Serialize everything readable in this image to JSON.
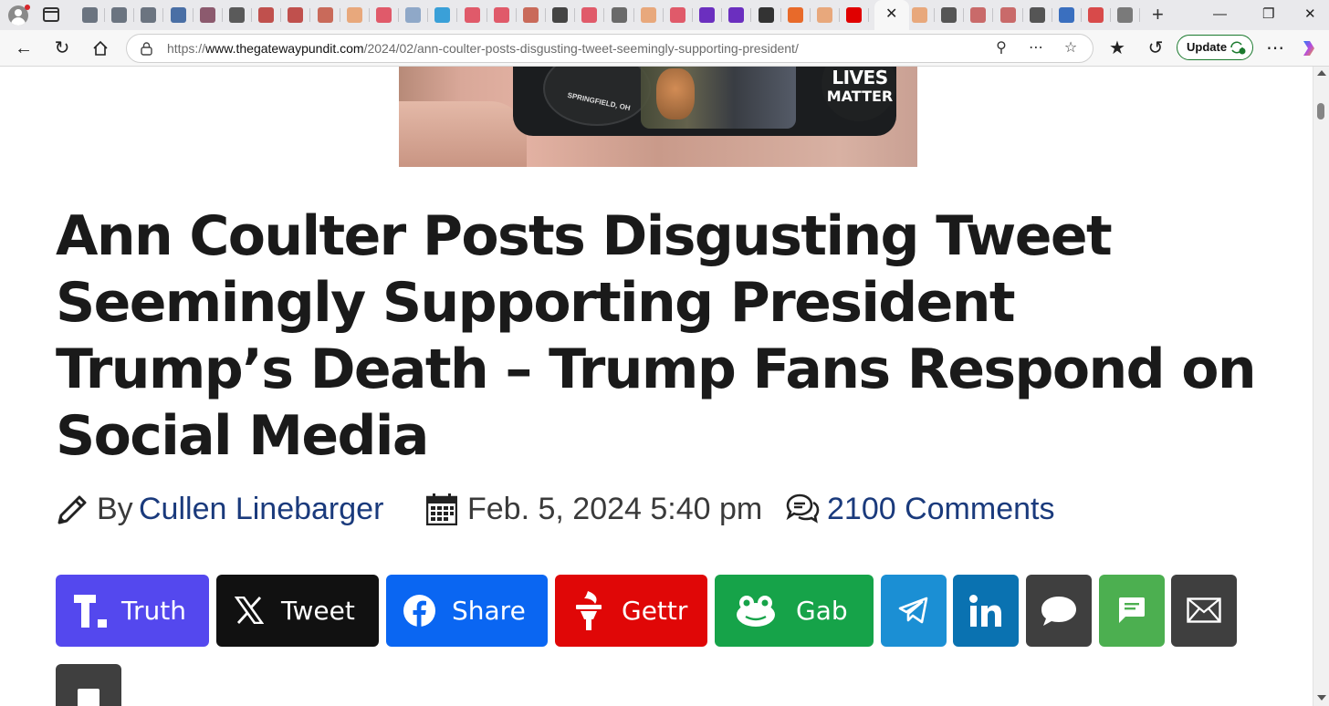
{
  "browser": {
    "tabs": [
      {
        "icon": "globe-icon",
        "color": "#6b7480"
      },
      {
        "icon": "globe-icon",
        "color": "#6b7480"
      },
      {
        "icon": "globe-icon",
        "color": "#6b7480"
      },
      {
        "icon": "news-icon",
        "color": "#4a6fa5"
      },
      {
        "icon": "tag-icon",
        "color": "#8c5a6e"
      },
      {
        "icon": "arrow-icon",
        "color": "#5a5a5a"
      },
      {
        "icon": "r-icon",
        "color": "#c0504d"
      },
      {
        "icon": "r-icon",
        "color": "#c0504d"
      },
      {
        "icon": "doc-icon",
        "color": "#c96a5a"
      },
      {
        "icon": "circle-icon",
        "color": "#e8a87c"
      },
      {
        "icon": "play-icon",
        "color": "#e05a6a"
      },
      {
        "icon": "pen-icon",
        "color": "#8fa8c8"
      },
      {
        "icon": "c-icon",
        "color": "#3aa0d8"
      },
      {
        "icon": "play-icon",
        "color": "#e05a6a"
      },
      {
        "icon": "play-icon",
        "color": "#e05a6a"
      },
      {
        "icon": "doc-icon",
        "color": "#c96a5a"
      },
      {
        "icon": "nr-icon",
        "color": "#444444"
      },
      {
        "icon": "play-icon",
        "color": "#e05a6a"
      },
      {
        "icon": "gp-icon",
        "color": "#6a6a6a"
      },
      {
        "icon": "b-icon",
        "color": "#e8a87c"
      },
      {
        "icon": "play-icon",
        "color": "#e05a6a"
      },
      {
        "icon": "yahoo-icon",
        "color": "#6b2fbf"
      },
      {
        "icon": "yahoo-icon",
        "color": "#6b2fbf"
      },
      {
        "icon": "ap-icon",
        "color": "#333333"
      },
      {
        "icon": "bookmark-icon",
        "color": "#e86a2a"
      },
      {
        "icon": "bookmark-icon",
        "color": "#e8a87c"
      },
      {
        "icon": "youtube-icon",
        "color": "#e00000"
      }
    ],
    "tabs_after": [
      {
        "icon": "bookmark-icon",
        "color": "#e8a87c"
      },
      {
        "icon": "r-icon",
        "color": "#555555"
      },
      {
        "icon": "m-icon",
        "color": "#c96a6a"
      },
      {
        "icon": "m-icon",
        "color": "#c96a6a"
      },
      {
        "icon": "r-icon",
        "color": "#555555"
      },
      {
        "icon": "h-icon",
        "color": "#3a6fbf"
      },
      {
        "icon": "s-icon",
        "color": "#d84a4a"
      },
      {
        "icon": "google-icon",
        "color": "#7a7a7a"
      }
    ],
    "active_tab_close": "✕",
    "new_tab": "+",
    "url_prefix": "https://",
    "url_host": "www.thegatewaypundit.com",
    "url_path": "/2024/02/ann-coulter-posts-disgusting-tweet-seemingly-supporting-president/",
    "update_label": "Update"
  },
  "article": {
    "headline": "Ann Coulter Posts Disgusting Tweet Seemingly Supporting President Trump’s Death – Trump Fans Respond on Social Media",
    "by_label": "By",
    "author": "Cullen Linebarger",
    "date": "Feb. 5, 2024 5:40 pm",
    "comments": "2100 Comments",
    "ad_text": {
      "lives": "LIVES",
      "matter": "MATTER",
      "springfield": "SPRINGFIELD, OH"
    }
  },
  "share_buttons": [
    {
      "label": "Truth",
      "color": "#5448ee",
      "icon": "truth-icon"
    },
    {
      "label": "Tweet",
      "color": "#111111",
      "icon": "x-icon"
    },
    {
      "label": "Share",
      "color": "#0a66f2",
      "icon": "facebook-icon"
    },
    {
      "label": "Gettr",
      "color": "#e00707",
      "icon": "gettr-icon"
    },
    {
      "label": "Gab",
      "color": "#16a349",
      "icon": "gab-icon"
    },
    {
      "label": "",
      "color": "#1b8fd4",
      "icon": "telegram-icon"
    },
    {
      "label": "",
      "color": "#0a72b1",
      "icon": "linkedin-icon"
    },
    {
      "label": "",
      "color": "#3f3f3f",
      "icon": "comment-icon"
    },
    {
      "label": "",
      "color": "#4caf50",
      "icon": "sms-icon"
    },
    {
      "label": "",
      "color": "#3f3f3f",
      "icon": "email-icon"
    }
  ]
}
